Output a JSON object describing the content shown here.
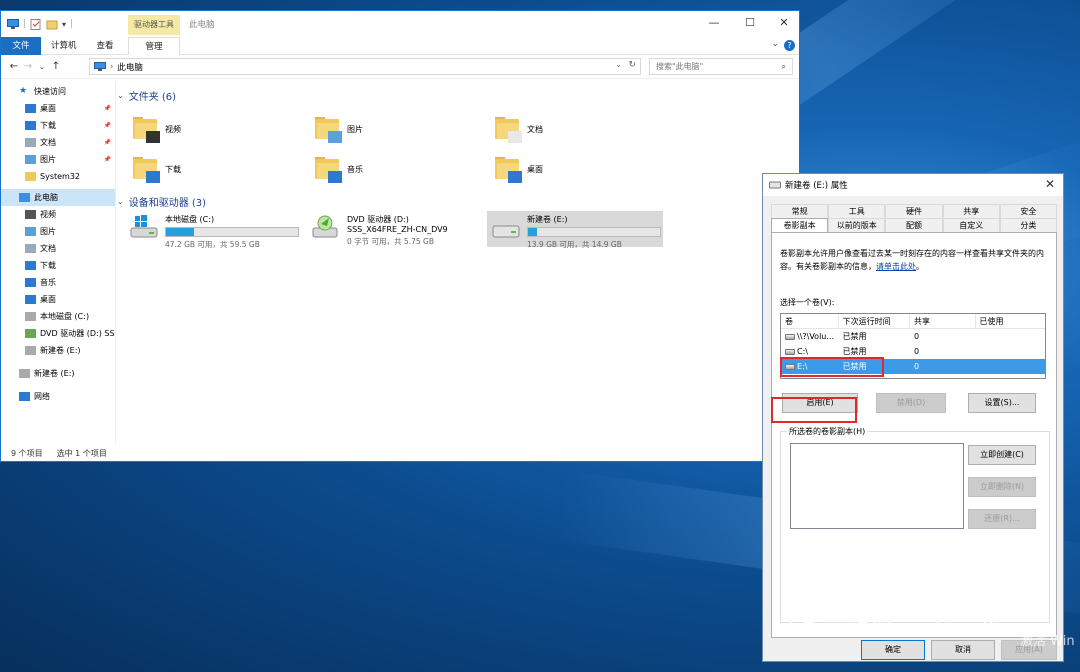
{
  "explorer": {
    "title": "此电脑",
    "context_tab_group": "驱动器工具",
    "tabs": [
      "文件",
      "计算机",
      "查看"
    ],
    "context_tab": "管理",
    "address": "此电脑",
    "search_placeholder": "搜索\"此电脑\"",
    "sidebar": [
      {
        "label": "快速访问",
        "icon": "star-icon",
        "pinned": false,
        "indent": 1
      },
      {
        "label": "桌面",
        "icon": "desktop-icon",
        "pinned": true,
        "indent": 2
      },
      {
        "label": "下载",
        "icon": "download-icon",
        "pinned": true,
        "indent": 2
      },
      {
        "label": "文档",
        "icon": "document-icon",
        "pinned": true,
        "indent": 2
      },
      {
        "label": "图片",
        "icon": "picture-icon",
        "pinned": true,
        "indent": 2
      },
      {
        "label": "System32",
        "icon": "folder-icon",
        "pinned": false,
        "indent": 2
      },
      {
        "label": "此电脑",
        "icon": "computer-icon",
        "pinned": false,
        "indent": 1,
        "selected": true
      },
      {
        "label": "视频",
        "icon": "video-icon",
        "pinned": false,
        "indent": 2
      },
      {
        "label": "图片",
        "icon": "picture-icon",
        "pinned": false,
        "indent": 2
      },
      {
        "label": "文档",
        "icon": "document-icon",
        "pinned": false,
        "indent": 2
      },
      {
        "label": "下载",
        "icon": "download-icon",
        "pinned": false,
        "indent": 2
      },
      {
        "label": "音乐",
        "icon": "music-icon",
        "pinned": false,
        "indent": 2
      },
      {
        "label": "桌面",
        "icon": "desktop-icon",
        "pinned": false,
        "indent": 2
      },
      {
        "label": "本地磁盘 (C:)",
        "icon": "drive-icon",
        "pinned": false,
        "indent": 2
      },
      {
        "label": "DVD 驱动器 (D:) SS",
        "icon": "dvd-icon",
        "pinned": false,
        "indent": 2
      },
      {
        "label": "新建卷 (E:)",
        "icon": "drive-icon",
        "pinned": false,
        "indent": 2
      },
      {
        "label": "新建卷 (E:)",
        "icon": "drive-icon",
        "pinned": false,
        "indent": 1
      },
      {
        "label": "网络",
        "icon": "network-icon",
        "pinned": false,
        "indent": 1
      }
    ],
    "folders_section": "文件夹 (6)",
    "folders": [
      {
        "label": "视频",
        "icon": "video-folder-icon"
      },
      {
        "label": "图片",
        "icon": "picture-folder-icon"
      },
      {
        "label": "文档",
        "icon": "document-folder-icon"
      },
      {
        "label": "下载",
        "icon": "download-folder-icon"
      },
      {
        "label": "音乐",
        "icon": "music-folder-icon"
      },
      {
        "label": "桌面",
        "icon": "desktop-folder-icon"
      }
    ],
    "drives_section": "设备和驱动器 (3)",
    "drives": [
      {
        "name": "本地磁盘 (C:)",
        "sub": "47.2 GB 可用，共 59.5 GB",
        "used_fraction": 0.21,
        "icon": "windows-drive-icon"
      },
      {
        "name": "DVD 驱动器 (D:)",
        "name2": "SSS_X64FRE_ZH-CN_DV9",
        "sub": "0 字节 可用，共 5.75 GB",
        "used_fraction": null,
        "icon": "dvd-drive-icon"
      },
      {
        "name": "新建卷 (E:)",
        "sub": "13.9 GB 可用，共 14.9 GB",
        "used_fraction": 0.07,
        "icon": "drive-icon",
        "selected": true
      }
    ],
    "status": {
      "items": "9 个项目",
      "selected": "选中 1 个项目"
    }
  },
  "dialog": {
    "title": "新建卷 (E:) 属性",
    "tabs_row1": [
      "常规",
      "工具",
      "硬件",
      "共享",
      "安全"
    ],
    "tabs_row2": [
      "卷影副本",
      "以前的版本",
      "配额",
      "自定义",
      "分类"
    ],
    "active_tab": "卷影副本",
    "description": "卷影副本允许用户像查看过去某一时刻存在的内容一样查看共享文件夹的内容。有关卷影副本的信息，",
    "description_link": "请单击此处",
    "description_end": "。",
    "select_volume_label": "选择一个卷(V):",
    "columns": [
      "卷",
      "下次运行时间",
      "共享",
      "已使用"
    ],
    "rows": [
      {
        "volume": "\\\\?\\Volu...",
        "next_run": "已禁用",
        "shares": "0",
        "used": ""
      },
      {
        "volume": "C:\\",
        "next_run": "已禁用",
        "shares": "0",
        "used": ""
      },
      {
        "volume": "E:\\",
        "next_run": "已禁用",
        "shares": "0",
        "used": "",
        "selected": true
      }
    ],
    "enable_button": "启用(E)",
    "disable_button": "禁用(D)",
    "settings_button": "设置(S)...",
    "copies_label": "所选卷的卷影副本(H)",
    "create_now": "立即创建(C)",
    "delete_now": "立即删除(N)",
    "revert": "还原(R)...",
    "ok": "确定",
    "cancel": "取消",
    "apply": "应用(A)"
  },
  "overlay": {
    "watermark_text": "爱婷如命一生一世",
    "activate_text": "激活 Win"
  },
  "colors": {
    "accent": "#1a6fc4",
    "selection": "#3c9ae8",
    "highlight_box": "#e02a2a"
  }
}
